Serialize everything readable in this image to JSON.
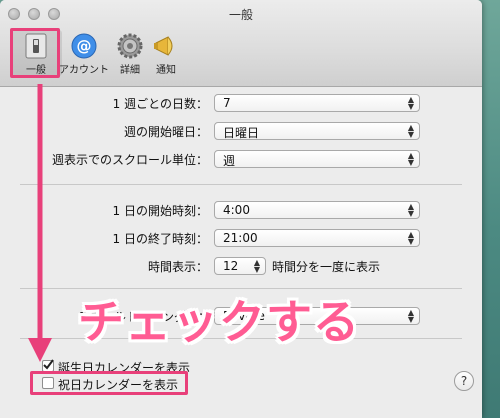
{
  "window": {
    "title": "一般"
  },
  "toolbar": {
    "items": [
      {
        "label": "一般",
        "icon": "general-switch-icon",
        "selected": true
      },
      {
        "label": "アカウント",
        "icon": "at-sign-icon"
      },
      {
        "label": "詳細",
        "icon": "gear-icon"
      },
      {
        "label": "通知",
        "icon": "megaphone-icon"
      }
    ]
  },
  "settings": {
    "days_per_week": {
      "label": "1 週ごとの日数：",
      "value": "7"
    },
    "week_start": {
      "label": "週の開始曜日：",
      "value": "日曜日"
    },
    "scroll_unit": {
      "label": "週表示でのスクロール単位：",
      "value": "週"
    },
    "day_start": {
      "label": "1 日の開始時刻：",
      "value": "4:00"
    },
    "day_end": {
      "label": "1 日の終了時刻：",
      "value": "21:00"
    },
    "time_display": {
      "label": "時間表示：",
      "value": "12",
      "suffix": "時間分を一度に表示"
    },
    "default_calendar": {
      "label": "デフォルトカレンダー：",
      "value": "Private"
    }
  },
  "checkboxes": {
    "birthdays": {
      "label": "誕生日カレンダーを表示",
      "checked": true
    },
    "holidays": {
      "label": "祝日カレンダーを表示",
      "checked": false
    }
  },
  "help": {
    "label": "?"
  },
  "annotation": {
    "text": "チェックする",
    "color": "#e8407a"
  }
}
